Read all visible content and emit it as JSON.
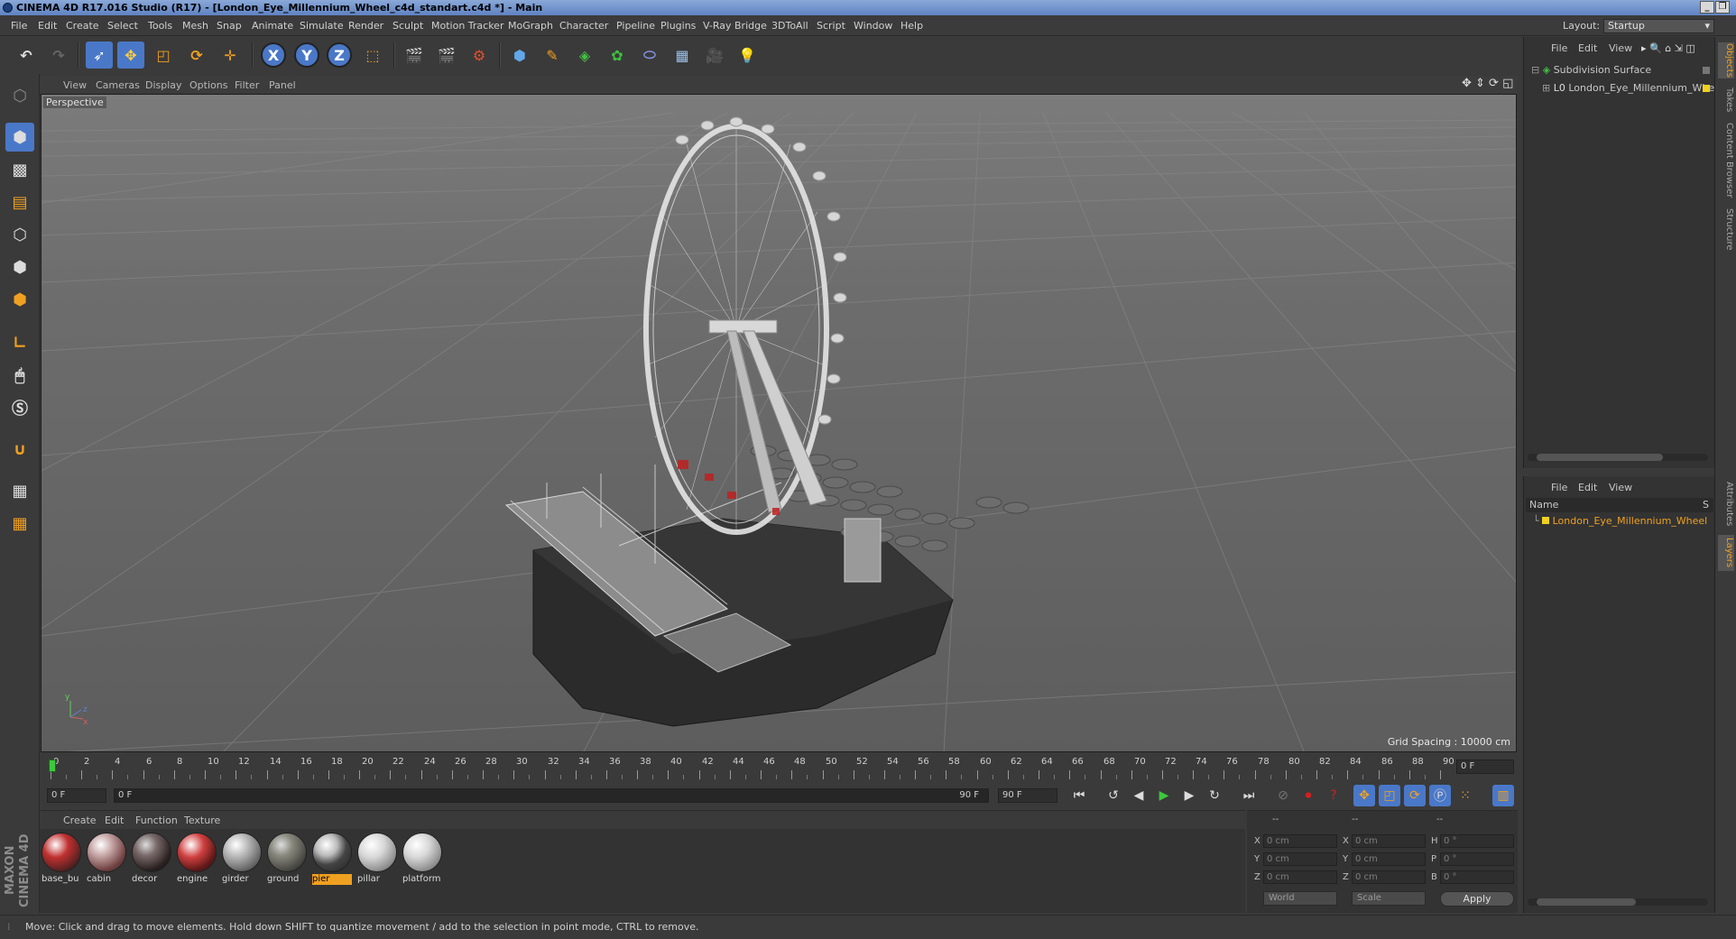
{
  "window": {
    "title": "CINEMA 4D R17.016 Studio (R17) - [London_Eye_Millennium_Wheel_c4d_standart.c4d *] - Main",
    "controls": [
      "_",
      "❐",
      "✕"
    ]
  },
  "menubar": {
    "items": [
      "File",
      "Edit",
      "Create",
      "Select",
      "Tools",
      "Mesh",
      "Snap",
      "Animate",
      "Simulate",
      "Render",
      "Sculpt",
      "Motion Tracker",
      "MoGraph",
      "Character",
      "Pipeline",
      "Plugins",
      "V-Ray Bridge",
      "3DToAll",
      "Script",
      "Window",
      "Help"
    ],
    "layout_label": "Layout:",
    "layout_value": "Startup"
  },
  "toolbar": {
    "axis_x": "X",
    "axis_y": "Y",
    "axis_z": "Z"
  },
  "viewport": {
    "menu": [
      "View",
      "Cameras",
      "Display",
      "Options",
      "Filter",
      "Panel"
    ],
    "label": "Perspective",
    "grid_spacing": "Grid Spacing : 10000 cm"
  },
  "timeline": {
    "ticks": [
      "0",
      "2",
      "4",
      "6",
      "8",
      "10",
      "12",
      "14",
      "16",
      "18",
      "20",
      "22",
      "24",
      "26",
      "28",
      "30",
      "32",
      "34",
      "36",
      "38",
      "40",
      "42",
      "44",
      "46",
      "48",
      "50",
      "52",
      "54",
      "56",
      "58",
      "60",
      "62",
      "64",
      "66",
      "68",
      "70",
      "72",
      "74",
      "76",
      "78",
      "80",
      "82",
      "84",
      "86",
      "88",
      "90"
    ],
    "current_frame": "0 F",
    "start_frame": "0 F",
    "range_start": "0 F",
    "range_end": "90 F",
    "end_frame": "90 F"
  },
  "materials": {
    "menu": [
      "Create",
      "Edit",
      "Function",
      "Texture"
    ],
    "items": [
      {
        "name": "base_bu",
        "selected": false
      },
      {
        "name": "cabin",
        "selected": false
      },
      {
        "name": "decor",
        "selected": false
      },
      {
        "name": "engine",
        "selected": false
      },
      {
        "name": "girder",
        "selected": false
      },
      {
        "name": "ground",
        "selected": false
      },
      {
        "name": "pier",
        "selected": true
      },
      {
        "name": "pillar",
        "selected": false
      },
      {
        "name": "platform",
        "selected": false
      }
    ],
    "logo": "MAXON CINEMA 4D"
  },
  "coordinates": {
    "headers": [
      "--",
      "--",
      "--"
    ],
    "rows": [
      {
        "pos_label": "X",
        "pos": "0 cm",
        "size_label": "X",
        "size": "0 cm",
        "rot_label": "H",
        "rot": "0 °"
      },
      {
        "pos_label": "Y",
        "pos": "0 cm",
        "size_label": "Y",
        "size": "0 cm",
        "rot_label": "P",
        "rot": "0 °"
      },
      {
        "pos_label": "Z",
        "pos": "0 cm",
        "size_label": "Z",
        "size": "0 cm",
        "rot_label": "B",
        "rot": "0 °"
      }
    ],
    "mode": "World",
    "size_mode": "Scale",
    "apply": "Apply"
  },
  "objects_panel": {
    "menu": [
      "File",
      "Edit",
      "View"
    ],
    "tree": [
      {
        "name": "Subdivision Surface",
        "color": "#c8c8c8"
      },
      {
        "name": "London_Eye_Millennium_Wheel",
        "color": "#c8c8c8"
      }
    ]
  },
  "layers_panel": {
    "menu": [
      "File",
      "Edit",
      "View"
    ],
    "column_name": "Name",
    "column_s": "S",
    "rows": [
      {
        "name": "London_Eye_Millennium_Wheel",
        "color": "#f0a020"
      }
    ]
  },
  "right_tabs": [
    "Objects",
    "Takes",
    "Content Browser",
    "Structure",
    "Attributes",
    "Layers"
  ],
  "status": "Move: Click and drag to move elements. Hold down SHIFT to quantize movement / add to the selection in point mode, CTRL to remove.",
  "colors": {
    "accent": "#f0a020",
    "selection_blue": "#4a78c8",
    "play_green": "#3cc83c",
    "record_red": "#d02020"
  }
}
